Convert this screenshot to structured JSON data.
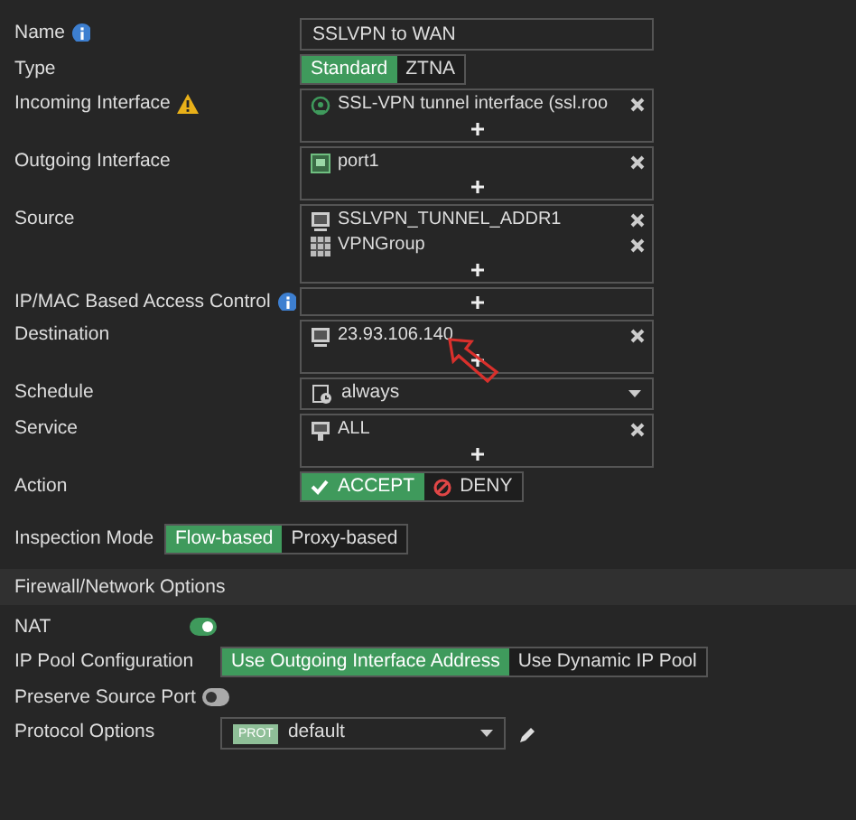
{
  "fields": [
    {
      "kind": "text",
      "label": "Name",
      "info_badge": true,
      "value": "SSLVPN to WAN"
    },
    {
      "kind": "segmented",
      "label": "Type",
      "options": [
        {
          "label": "Standard",
          "selected": true
        },
        {
          "label": "ZTNA",
          "selected": false
        }
      ]
    },
    {
      "kind": "list",
      "label": "Incoming Interface",
      "warning_badge": true,
      "entries": [
        {
          "kind": "tunnel",
          "text": "SSL-VPN tunnel interface (ssl.roo"
        }
      ]
    },
    {
      "kind": "list",
      "label": "Outgoing Interface",
      "entries": [
        {
          "kind": "port",
          "text": "port1"
        }
      ]
    },
    {
      "kind": "list",
      "label": "Source",
      "entries": [
        {
          "kind": "address",
          "text": "SSLVPN_TUNNEL_ADDR1"
        },
        {
          "kind": "group",
          "text": "VPNGroup"
        }
      ]
    },
    {
      "kind": "list",
      "label": "IP/MAC Based Access Control",
      "info_badge": true
    },
    {
      "kind": "list",
      "label": "Destination",
      "entries": [
        {
          "kind": "address",
          "text": "23.93.106.140"
        }
      ],
      "annotated": true
    },
    {
      "kind": "select",
      "label": "Schedule",
      "value": "always"
    },
    {
      "kind": "list",
      "label": "Service",
      "entries": [
        {
          "kind": "service",
          "text": "ALL"
        }
      ]
    },
    {
      "kind": "segmented",
      "label": "Action",
      "options": [
        {
          "label": "ACCEPT",
          "selected": true
        },
        {
          "label": "DENY",
          "selected": false
        }
      ]
    }
  ],
  "inspection_mode": {
    "label": "Inspection Mode",
    "options": [
      {
        "label": "Flow-based",
        "selected": true
      },
      {
        "label": "Proxy-based",
        "selected": false
      }
    ]
  },
  "section": {
    "title": "Firewall/Network Options",
    "rows": [
      {
        "kind": "toggle",
        "label": "NAT",
        "on": true
      },
      {
        "kind": "segmented",
        "label": "IP Pool Configuration",
        "options": [
          {
            "label": "Use Outgoing Interface Address",
            "selected": true
          },
          {
            "label": "Use Dynamic IP Pool",
            "selected": false
          }
        ]
      },
      {
        "kind": "toggle",
        "label": "Preserve Source Port",
        "on": false
      },
      {
        "kind": "select",
        "label": "Protocol Options",
        "tag": "PROT",
        "value": "default",
        "editable": true
      }
    ]
  }
}
